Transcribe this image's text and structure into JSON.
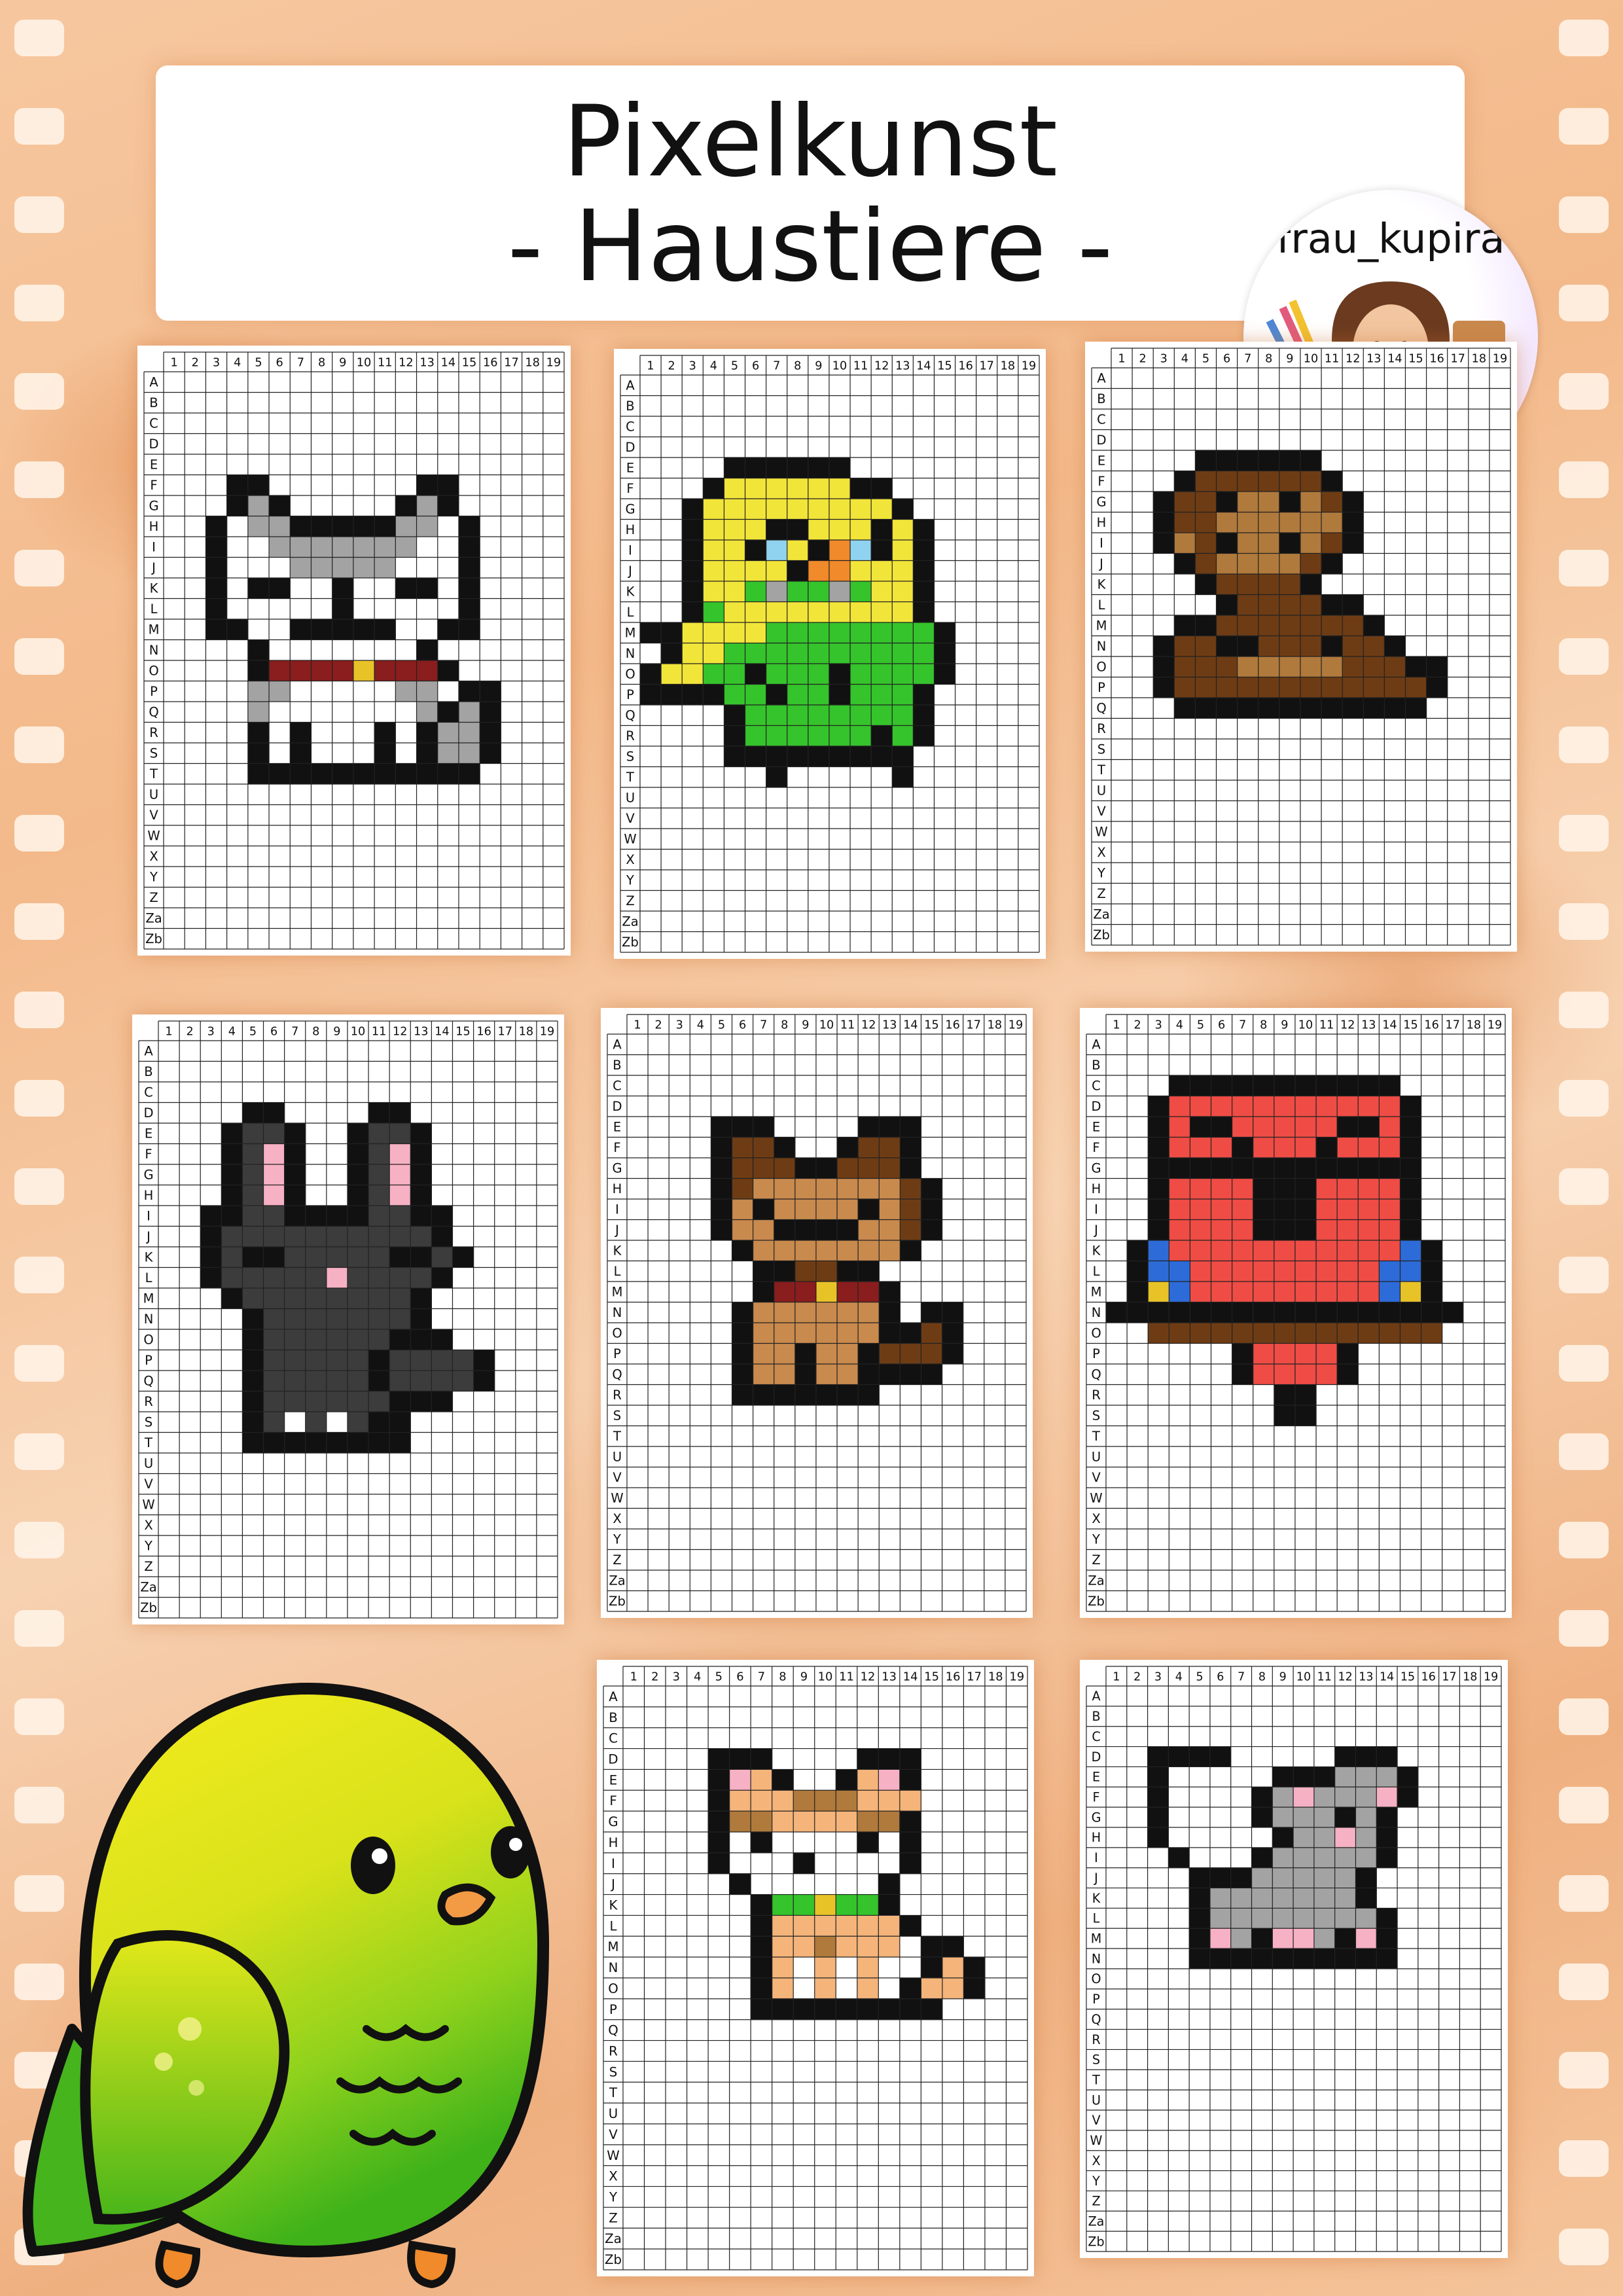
{
  "title": {
    "line1": "Pixelkunst",
    "line2": "- Haustiere -"
  },
  "author": {
    "handle": "frau_kupira"
  },
  "grid": {
    "column_labels": [
      "1",
      "2",
      "3",
      "4",
      "5",
      "6",
      "7",
      "8",
      "9",
      "10",
      "11",
      "12",
      "13",
      "14",
      "15",
      "16",
      "17",
      "18",
      "19"
    ],
    "row_labels": [
      "A",
      "B",
      "C",
      "D",
      "E",
      "F",
      "G",
      "H",
      "I",
      "J",
      "K",
      "L",
      "M",
      "N",
      "O",
      "P",
      "Q",
      "R",
      "S",
      "T",
      "U",
      "V",
      "W",
      "X",
      "Y",
      "Z",
      "Za",
      "Zb"
    ]
  },
  "colors": {
    "black": "#111111",
    "gray": "#a3a3a3",
    "darkgray": "#555555",
    "charcoal": "#3c3c3c",
    "yellow": "#f2e53a",
    "green": "#35c42b",
    "lightblue": "#8fd3f0",
    "orange": "#f08a2a",
    "brown": "#6e3c14",
    "tan": "#b07a3c",
    "lightbrown": "#c98a4e",
    "red": "#ef4c45",
    "blue": "#2d6bd8",
    "pink": "#f7b1c4",
    "maroon": "#8a1d1d",
    "gold": "#e8c328",
    "peach": "#f4b47a",
    "accent_orange": "#f07a20"
  },
  "cards": [
    {
      "id": "husky",
      "legend": {
        "k": "black",
        "g": "gray",
        "r": "maroon",
        "y": "gold"
      },
      "pixels": [
        "",
        "",
        "",
        "",
        "",
        "...kk.......kk...",
        "...kgk.....kgk...",
        "..k.ggkkkkkgg.k..",
        "..k..ggggggg..k..",
        "..k...ggggg...k..",
        "..k.kk..k..kk.k..",
        "..k.....k.....k..",
        "..kk..kkkkk..kk..",
        "....k.......k....",
        "....krrrryrrrk...",
        "....gg.....gg.kk.",
        "....g.......gkgk.",
        "....k.k...k.kggk.",
        "....k.k...k.kggk.",
        "....kkkkkkkkkkk..",
        "",
        "",
        "",
        "",
        "",
        "",
        "",
        ""
      ]
    },
    {
      "id": "budgie",
      "legend": {
        "k": "black",
        "y": "yellow",
        "g": "green",
        "b": "lightblue",
        "o": "orange",
        "d": "gray"
      },
      "pixels": [
        "",
        "",
        "",
        "",
        "....kkkkkk.........",
        "...kyyyyyykk.......",
        "..kyyyyyyyyyk......",
        "..kyyykkyyykyk.....",
        "..kyykbykobkyk.....",
        "..kyyyykooyyyk.....",
        "..kyygdggdgyyk.....",
        "..kgyyyyyyyyyk.....",
        "kkyyyyggggggggk....",
        ".kyyggggggggggk....",
        "kyyggkgggkggggk....",
        "kkkkggkggkgggk.....",
        "....kggggggggk.....",
        "....kggggggkgk.....",
        "....kkkkkkkkk......",
        "......k.....k......",
        "",
        "",
        "",
        "",
        "",
        "",
        "",
        ""
      ]
    },
    {
      "id": "monkey",
      "legend": {
        "k": "black",
        "b": "brown",
        "t": "tan"
      },
      "pixels": [
        "",
        "",
        "",
        "",
        "....kkkkkk......",
        "...kbbbbbbk.....",
        "..kbbkttktbk....",
        "..kbbttttttk....",
        "..ktbkttktbk....",
        "...kbttttbk.....",
        "....kbbbbk......",
        ".....kbbbbkk....",
        "...kkbbbbbbbk...",
        "..kbbkkbbbkbbk..",
        "..kbbbtttttbbbkk",
        "..kbbbbbbbbbbbbk",
        "...kkkkkkkkkkkk.",
        "",
        "",
        "",
        "",
        "",
        "",
        "",
        "",
        "",
        "",
        ""
      ]
    },
    {
      "id": "rabbit",
      "legend": {
        "k": "black",
        "c": "charcoal",
        "p": "pink",
        "w": "white"
      },
      "pixels": [
        "",
        "",
        "",
        "....kk....kk.....",
        "...kcck..kcck....",
        "...kcpk..kcpk....",
        "...kcpk..kcpk....",
        "...kcpk..kcpk....",
        "..kkcckkkkcckk...",
        "..kcccccccccck...",
        "..kckkccccckkck..",
        "..kcccccpcccck...",
        "...kcccccccck....",
        "....kccccccck....",
        "....kcccccckkk...",
        "....kccccckcccck.",
        "....kccccckcccck.",
        "....kcccccckkk...",
        "....kcwcwckk.....",
        "....kkkkkkkk.....",
        "",
        "",
        "",
        "",
        "",
        "",
        "",
        ""
      ]
    },
    {
      "id": "dog",
      "legend": {
        "k": "black",
        "b": "brown",
        "t": "lightbrown",
        "r": "maroon",
        "y": "gold"
      },
      "pixels": [
        "",
        "",
        "",
        "",
        "....kkk....kkk...",
        "....kbbk..kbbk...",
        "....kbbbkkbbbk...",
        "....kbtttttttbk..",
        "....ktkttttktbk..",
        "....kttkkkkttbk..",
        ".....ktttttttk...",
        "......kkbbkk.....",
        "......krryrrk....",
        ".....kttttttk.kk.",
        ".....kttttttkkbk.",
        ".....kttkttkbbbk.",
        ".....kttkttkkkk..",
        ".....kkkkkkk.....",
        "",
        "",
        "",
        "",
        "",
        "",
        "",
        "",
        "",
        ""
      ]
    },
    {
      "id": "parrot",
      "legend": {
        "k": "black",
        "r": "red",
        "b": "blue",
        "y": "gold",
        "n": "brown"
      },
      "pixels": [
        "",
        "",
        "...kkkkkkkkkkk.....",
        "..krrrrrrrrrrrk....",
        "..krkkrrrrrkkrk....",
        "..krrrkrrrkrrrk....",
        "..kkkkkkkkkkkkk....",
        "..krrrrkkkrrrrk....",
        "..krrrrkkkrrrrk....",
        "..krrrrkkkrrrrk....",
        ".kbrrrrrrrrrrrbk...",
        ".kbbrrrrrrrrrbbk...",
        ".kybrrrrrrrrrbyk...",
        "kkkkkkkkkkkkkkkkk..",
        "..nnnnnnnnnnnnnn...",
        "......krrrrk.......",
        "......krrrrk.......",
        "........kk.........",
        "........kk.........",
        "",
        "",
        "",
        "",
        "",
        "",
        "",
        "",
        ""
      ]
    },
    {
      "id": "cat",
      "legend": {
        "k": "black",
        "o": "peach",
        "b": "tan",
        "p": "pink",
        "w": "white",
        "g": "green",
        "y": "gold"
      },
      "pixels": [
        "",
        "",
        "",
        "....kkk....kkk....",
        "....kpok..kopk....",
        "....kooobbbooo....",
        "....kbboooobbk....",
        "....kwkwwwwkwk....",
        "....kwwwkwwwwk....",
        ".....kwwwwwwk.....",
        "......kggyggk.....",
        "......kooooook....",
        "......koobooo.kk..",
        "......kowowow.kok.",
        "......kowowowkook.",
        "......kkkkkkkkk...",
        "",
        "",
        "",
        "",
        "",
        "",
        "",
        "",
        "",
        "",
        "",
        ""
      ]
    },
    {
      "id": "mouse",
      "legend": {
        "k": "black",
        "g": "gray",
        "p": "pink"
      },
      "pixels": [
        "",
        "",
        "",
        "..kkkk.....kkk...",
        "..k.....kkkgggk..",
        "..k....kgpgggpk..",
        "..k....kgggkgk...",
        "..k.....kggpgk...",
        "...k...kgggggk...",
        "....kkkgggggk....",
        "....kgggggggk....",
        "....kggggggggk...",
        "....kpgkppgkpk...",
        "....kkkkkkkkkk...",
        "",
        "",
        "",
        "",
        "",
        "",
        "",
        "",
        "",
        "",
        "",
        "",
        "",
        ""
      ]
    }
  ]
}
